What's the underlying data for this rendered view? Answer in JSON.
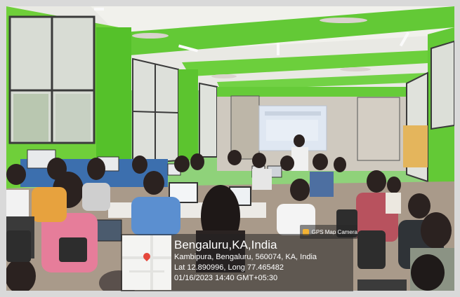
{
  "gps": {
    "badge": "GPS Map Camera",
    "title": "Bengaluru,KA,India",
    "address": "Kambipura, Bengaluru, 560074, KA, India",
    "coords": "Lat 12.890996, Long 77.465482",
    "datetime": "01/16/2023 14:40 GMT+05:30"
  },
  "colors": {
    "wall_green": "#6fcf3a",
    "ceiling": "#e9e9e4",
    "projection": "#dfe7f2",
    "floor": "#a99a8a"
  },
  "icons": {
    "badge_icon": "map-pin-icon",
    "map_pin": "map-pin-icon"
  }
}
